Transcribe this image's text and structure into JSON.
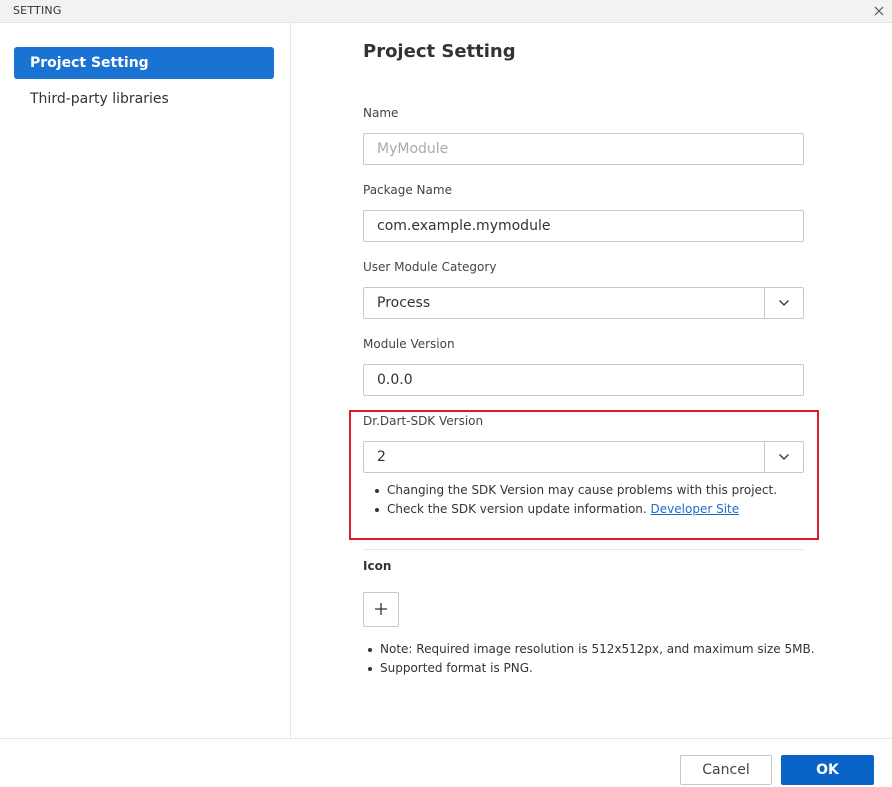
{
  "window": {
    "title": "SETTING",
    "close_icon": "close-icon"
  },
  "sidebar": {
    "items": [
      {
        "label": "Project Setting",
        "active": true
      },
      {
        "label": "Third-party libraries",
        "active": false
      }
    ]
  },
  "main": {
    "heading": "Project Setting",
    "name": {
      "label": "Name",
      "value": "",
      "placeholder": "MyModule"
    },
    "package_name": {
      "label": "Package Name",
      "value": "com.example.mymodule"
    },
    "category": {
      "label": "User Module Category",
      "value": "Process",
      "icon": "chevron-down-icon"
    },
    "module_version": {
      "label": "Module Version",
      "value": "0.0.0"
    },
    "sdk_version": {
      "label": "Dr.Dart-SDK Version",
      "value": "2",
      "icon": "chevron-down-icon",
      "notes": [
        "Changing the SDK Version may cause problems with this project.",
        "Check the SDK version update information."
      ],
      "link_text": "Developer Site",
      "highlight_color": "#dd1c2a"
    },
    "icon_section": {
      "label": "Icon",
      "add_icon": "plus-icon",
      "notes": [
        "Note: Required image resolution is 512x512px, and maximum size 5MB.",
        "Supported format is PNG."
      ]
    }
  },
  "footer": {
    "cancel_label": "Cancel",
    "ok_label": "OK"
  },
  "colors": {
    "accent": "#1a73d3",
    "ok_button": "#0a64c8",
    "link": "#1a6fc9"
  }
}
